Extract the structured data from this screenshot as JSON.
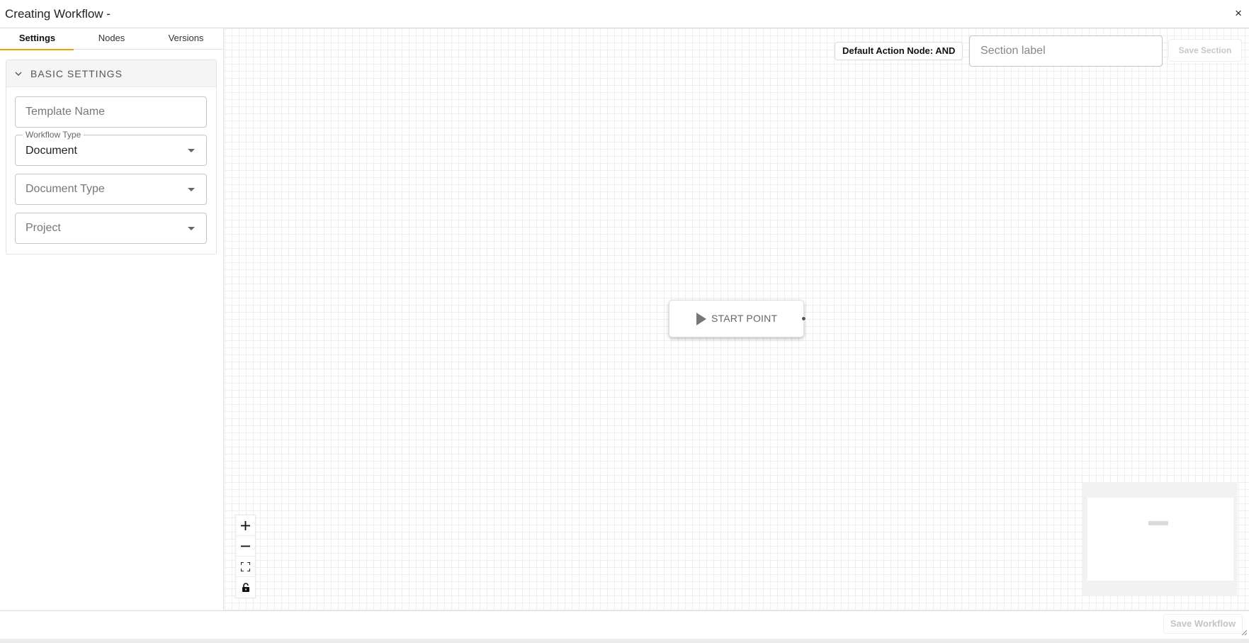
{
  "dialog": {
    "title": "Creating Workflow -",
    "close_symbol": "×"
  },
  "sidebar": {
    "tabs": [
      {
        "label": "Settings",
        "active": true
      },
      {
        "label": "Nodes",
        "active": false
      },
      {
        "label": "Versions",
        "active": false
      }
    ],
    "basic_settings": {
      "title": "BASIC SETTINGS",
      "template_name": {
        "placeholder": "Template Name",
        "value": ""
      },
      "workflow_type": {
        "label": "Workflow Type",
        "value": "Document"
      },
      "document_type": {
        "placeholder": "Document Type",
        "value": ""
      },
      "project": {
        "placeholder": "Project",
        "value": ""
      }
    }
  },
  "canvas": {
    "default_action_node": "Default Action Node: AND",
    "section_label": {
      "placeholder": "Section label",
      "value": ""
    },
    "save_section_label": "Save Section",
    "start_node_label": "START POINT",
    "controls": [
      "zoom-in-icon",
      "zoom-out-icon",
      "fit-view-icon",
      "lock-icon"
    ]
  },
  "footer": {
    "save_workflow_label": "Save Workflow"
  },
  "colors": {
    "accent": "#f0a000",
    "disabled_text": "#c4c4c4",
    "grid": "#eeeeee"
  }
}
